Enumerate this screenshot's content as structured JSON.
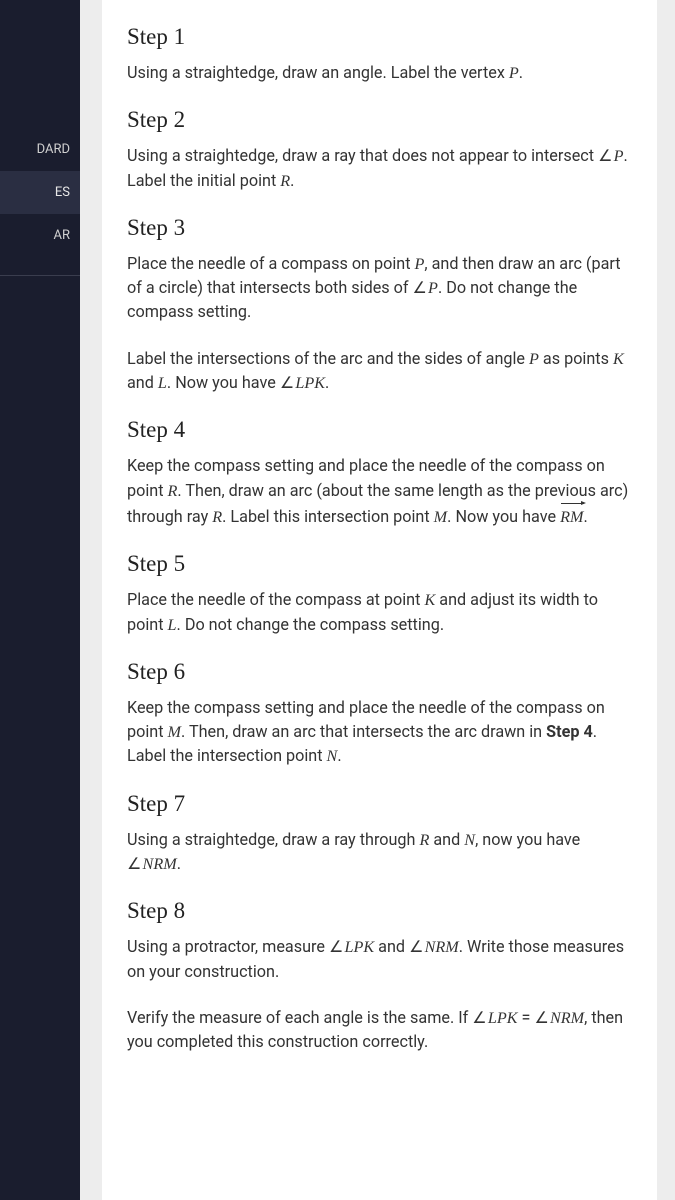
{
  "sidebar": {
    "items": [
      {
        "label": "DARD"
      },
      {
        "label": "ES"
      },
      {
        "label": "AR"
      }
    ]
  },
  "doc": {
    "steps": [
      {
        "title": "Step 1",
        "paras": [
          {
            "segments": [
              {
                "t": "Using a straightedge, draw an angle. Label the vertex "
              },
              {
                "t": "P",
                "mi": true
              },
              {
                "t": "."
              }
            ]
          }
        ]
      },
      {
        "title": "Step 2",
        "paras": [
          {
            "segments": [
              {
                "t": "Using a straightedge, draw a ray that does not appear to intersect "
              },
              {
                "t": "P",
                "angle": true,
                "mi": true
              },
              {
                "t": ". Label the initial point "
              },
              {
                "t": "R",
                "mi": true
              },
              {
                "t": "."
              }
            ]
          }
        ]
      },
      {
        "title": "Step 3",
        "paras": [
          {
            "segments": [
              {
                "t": "Place the needle of a compass on point "
              },
              {
                "t": "P",
                "mi": true
              },
              {
                "t": ", and then draw an arc (part of a circle) that intersects both sides of "
              },
              {
                "t": "P",
                "angle": true,
                "mi": true
              },
              {
                "t": ". Do not change the compass setting."
              }
            ]
          },
          {
            "segments": [
              {
                "t": "Label the intersections of the arc and the sides of angle "
              },
              {
                "t": "P",
                "mi": true
              },
              {
                "t": " as points "
              },
              {
                "t": "K",
                "mi": true
              },
              {
                "t": " and "
              },
              {
                "t": "L",
                "mi": true
              },
              {
                "t": ". Now you have "
              },
              {
                "t": "LPK",
                "angle": true,
                "mi": true
              },
              {
                "t": "."
              }
            ]
          }
        ]
      },
      {
        "title": "Step 4",
        "paras": [
          {
            "segments": [
              {
                "t": "Keep the compass setting and place the needle of the compass on point "
              },
              {
                "t": "R",
                "mi": true
              },
              {
                "t": ". Then, draw an arc (about the same length as the previous arc) through ray "
              },
              {
                "t": "R",
                "mi": true
              },
              {
                "t": ". Label this intersection point "
              },
              {
                "t": "M",
                "mi": true
              },
              {
                "t": ". Now you have "
              },
              {
                "t": "RM",
                "ray": true
              },
              {
                "t": "."
              }
            ]
          }
        ]
      },
      {
        "title": "Step 5",
        "paras": [
          {
            "segments": [
              {
                "t": "Place the needle of the compass at point "
              },
              {
                "t": "K",
                "mi": true
              },
              {
                "t": " and adjust its width to point "
              },
              {
                "t": "L",
                "mi": true
              },
              {
                "t": ". Do not change the compass setting."
              }
            ]
          }
        ]
      },
      {
        "title": "Step 6",
        "paras": [
          {
            "segments": [
              {
                "t": "Keep the compass setting and place the needle of the compass on point "
              },
              {
                "t": "M",
                "mi": true
              },
              {
                "t": ". Then, draw an arc that intersects the arc drawn in "
              },
              {
                "t": "Step 4",
                "bold": true
              },
              {
                "t": ". Label the intersection point "
              },
              {
                "t": "N",
                "mi": true
              },
              {
                "t": "."
              }
            ]
          }
        ]
      },
      {
        "title": "Step 7",
        "paras": [
          {
            "segments": [
              {
                "t": "Using a straightedge, draw a ray through "
              },
              {
                "t": "R",
                "mi": true
              },
              {
                "t": " and "
              },
              {
                "t": "N",
                "mi": true
              },
              {
                "t": ", now you have "
              },
              {
                "t": "NRM",
                "angle": true,
                "mi": true
              },
              {
                "t": "."
              }
            ]
          }
        ]
      },
      {
        "title": "Step 8",
        "paras": [
          {
            "segments": [
              {
                "t": "Using a protractor, measure "
              },
              {
                "t": "LPK",
                "angle": true,
                "mi": true
              },
              {
                "t": " and "
              },
              {
                "t": "NRM",
                "angle": true,
                "mi": true
              },
              {
                "t": ". Write those measures on your construction."
              }
            ]
          },
          {
            "segments": [
              {
                "t": "Verify the measure of each angle is the same. If "
              },
              {
                "t": "LPK",
                "angle": true,
                "mi": true
              },
              {
                "t": " = "
              },
              {
                "t": "NRM",
                "angle": true,
                "mi": true
              },
              {
                "t": ", then you completed this construction correctly."
              }
            ]
          }
        ]
      }
    ]
  }
}
